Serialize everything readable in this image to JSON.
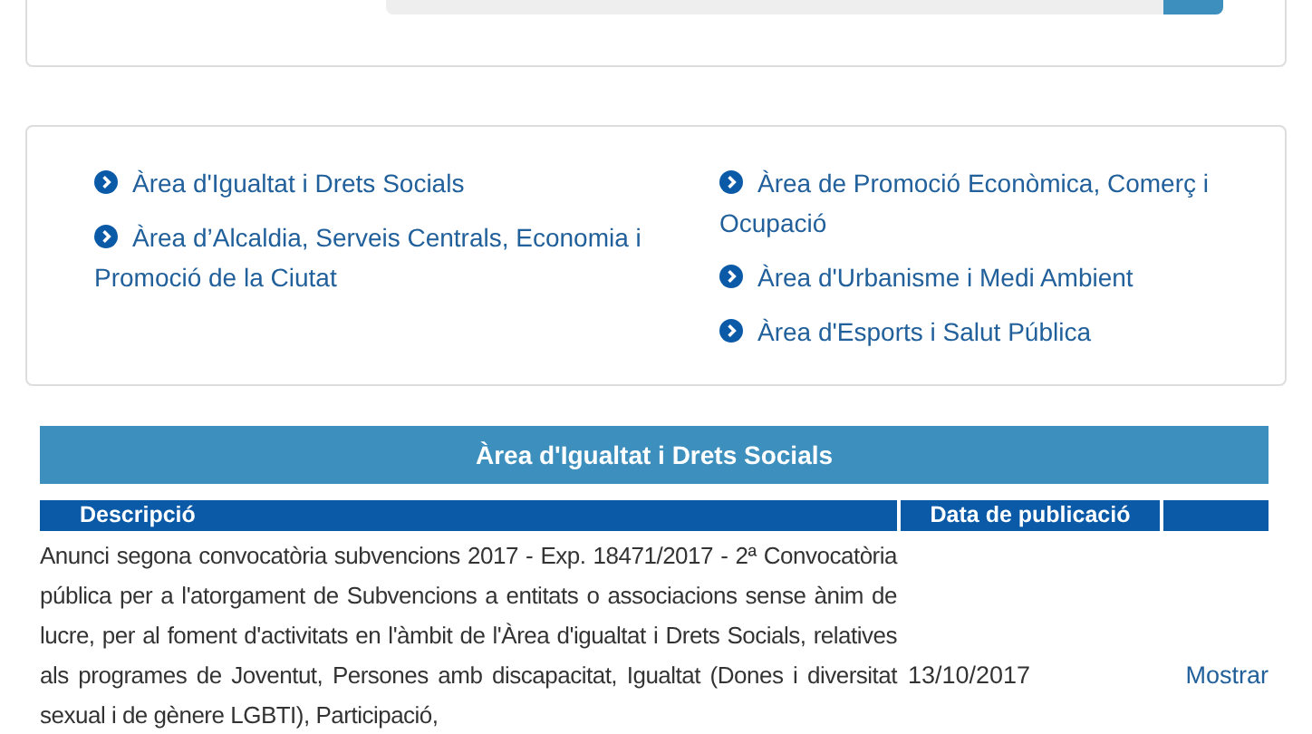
{
  "links_columns": [
    [
      "Àrea d'Igualtat i Drets Socials",
      "Àrea d’Alcaldia, Serveis Centrals, Economia i Promoció de la Ciutat"
    ],
    [
      "Àrea de Promoció Econòmica, Comerç i Ocupació",
      "Àrea d'Urbanisme i Medi Ambient",
      "Àrea d'Esports i Salut Pública"
    ]
  ],
  "section_title": "Àrea d'Igualtat i Drets Socials",
  "table": {
    "columns": [
      "Descripció",
      "Data de publicació"
    ],
    "rows": [
      {
        "description": "Anunci segona convocatòria subvencions 2017 - Exp. 18471/2017 - 2ª Convocatòria pública per a l'atorgament de Subvencions a entitats o associacions sense ànim de lucre, per al foment d'activitats en l'àmbit de l'Àrea d'igualtat i Drets Socials, relatives als programes de Joventut, Persones amb discapacitat, Igualtat (Dones i diversitat sexual i de gènere LGBTI), Participació,",
        "date": "13/10/2017",
        "action": "Mostrar"
      }
    ]
  }
}
